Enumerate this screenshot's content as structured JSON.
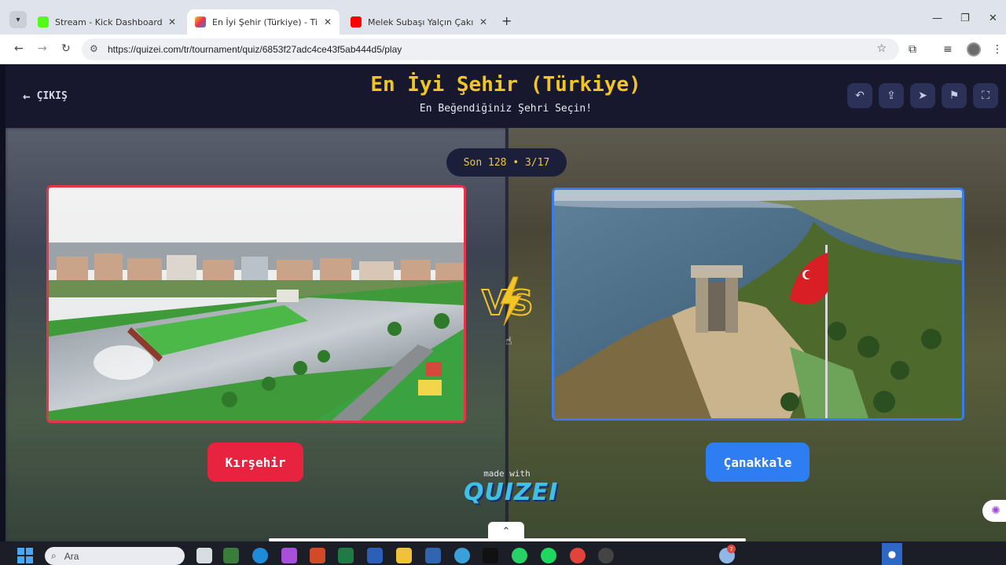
{
  "browser": {
    "tabs": [
      {
        "title": "Stream - Kick Dashboard",
        "favicon_color": "#53fc18",
        "active": false
      },
      {
        "title": "En İyi Şehir (Türkiye) - Tier List,",
        "favicon_color": "#f2c526",
        "active": true
      },
      {
        "title": "Melek Subaşı Yalçın Çakır Doğu",
        "favicon_color": "#ff0000",
        "active": false
      }
    ],
    "url": "https://quizei.com/tr/tournament/quiz/6853f27adc4ce43f5ab444d5/play"
  },
  "header": {
    "exit_label": "ÇIKIŞ",
    "title": "En İyi Şehir (Türkiye)",
    "subtitle": "En Beğendiğiniz Şehri Seçin!",
    "tools": [
      "undo-icon",
      "share-icon",
      "send-icon",
      "flag-icon",
      "fullscreen-icon"
    ]
  },
  "match": {
    "counter": "Son 128 • 3/17",
    "vs_text": "VS",
    "left_option": {
      "name": "Kırşehir",
      "accent": "#e8233f"
    },
    "right_option": {
      "name": "Çanakkale",
      "accent": "#2f7df3"
    }
  },
  "footer": {
    "made_with": "made with",
    "brand": "QUIZEI"
  },
  "taskbar": {
    "search_placeholder": "Ara",
    "notification_count": "7"
  }
}
